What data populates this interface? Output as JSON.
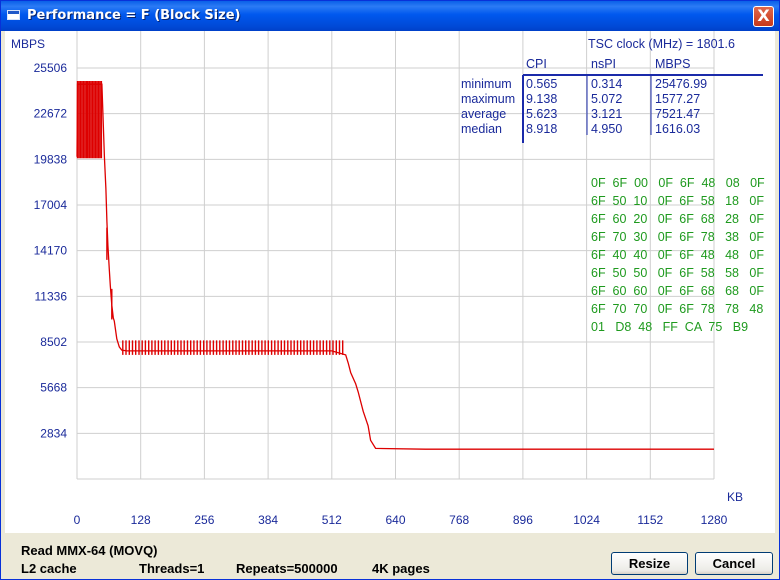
{
  "window": {
    "title": "Performance = F (Block Size)",
    "close_label": "X"
  },
  "chart_data": {
    "type": "line",
    "ylabel": "MBPS",
    "xlabel": "KB",
    "y_ticks": [
      "25506",
      "22672",
      "19838",
      "17004",
      "14170",
      "11336",
      "8502",
      "5668",
      "2834"
    ],
    "y_tick_values": [
      25506,
      22672,
      19838,
      17004,
      14170,
      11336,
      8502,
      5668,
      2834
    ],
    "x_ticks": [
      "0",
      "128",
      "256",
      "384",
      "512",
      "640",
      "768",
      "896",
      "1024",
      "1152",
      "1280"
    ],
    "x_tick_values": [
      0,
      128,
      256,
      384,
      512,
      640,
      768,
      896,
      1024,
      1152,
      1280
    ],
    "ylim": [
      0,
      25506
    ],
    "xlim": [
      0,
      1280
    ],
    "grid": true,
    "series_color": "#DD0000",
    "series": [
      {
        "x": [
          0,
          1,
          50,
          55,
          58,
          60,
          62,
          65,
          67,
          70,
          73,
          75,
          80,
          85,
          90,
          100,
          200,
          300,
          400,
          512,
          540,
          545,
          550,
          560,
          565,
          575,
          585,
          590,
          600,
          700,
          800,
          900,
          1000,
          1100,
          1200,
          1280
        ],
        "y": [
          20000,
          24500,
          24500,
          20000,
          18000,
          16000,
          14500,
          13000,
          12000,
          10800,
          10000,
          9800,
          8700,
          8200,
          8000,
          7950,
          7950,
          7950,
          7950,
          7950,
          7700,
          7200,
          6600,
          5900,
          5400,
          4200,
          3300,
          2400,
          1900,
          1850,
          1850,
          1850,
          1850,
          1850,
          1850,
          1850
        ]
      }
    ]
  },
  "stats": {
    "tsc_label": "TSC clock (MHz)  = 1801.6",
    "headers": [
      "CPI",
      "nsPI",
      "MBPS"
    ],
    "rows": [
      {
        "label": "minimum",
        "cpi": "0.565",
        "nspi": "0.314",
        "mbps": "25476.99"
      },
      {
        "label": "maximum",
        "cpi": "9.138",
        "nspi": "5.072",
        "mbps": "1577.27"
      },
      {
        "label": "average",
        "cpi": "5.623",
        "nspi": "3.121",
        "mbps": "7521.47"
      },
      {
        "label": "median",
        "cpi": "8.918",
        "nspi": "4.950",
        "mbps": "1616.03"
      }
    ]
  },
  "opcodes": [
    "0F  6F  00   0F  6F  48   08   0F",
    "6F  50  10   0F  6F  58   18   0F",
    "6F  60  20   0F  6F  68   28   0F",
    "6F  70  30   0F  6F  78   38   0F",
    "6F  40  40   0F  6F  48   48   0F",
    "6F  50  50   0F  6F  58   58   0F",
    "6F  60  60   0F  6F  68   68   0F",
    "6F  70  70   0F  6F  78   78   48",
    "01   D8  48   FF  CA  75   B9"
  ],
  "status": {
    "method": "Read MMX-64 (MOVQ)",
    "cache": "L2 cache",
    "threads": "Threads=1",
    "repeats": "Repeats=500000",
    "pages": "4K pages"
  },
  "buttons": {
    "resize": "Resize",
    "cancel": "Cancel"
  }
}
